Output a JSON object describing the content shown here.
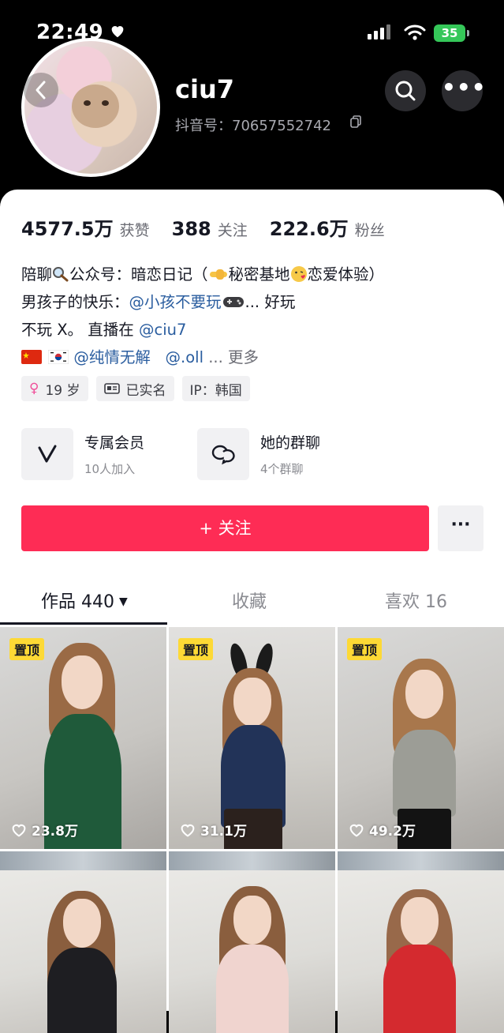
{
  "status_bar": {
    "time": "22:49",
    "battery": "35"
  },
  "profile": {
    "username": "ciu7",
    "douyin_id": "抖音号：70657552742"
  },
  "stats": [
    {
      "value": "4577.5万",
      "label": "获赞"
    },
    {
      "value": "388",
      "label": "关注"
    },
    {
      "value": "222.6万",
      "label": "粉丝"
    }
  ],
  "bio": {
    "line1_a": "陪聊",
    "line1_b": "公众号：暗恋日记（",
    "line1_c": "秘密基地",
    "line1_d": "恋爱体验）",
    "line2_a": "男孩子的快乐：",
    "line2_mention": "@小孩不要玩",
    "line2_b": "... 好玩",
    "line3_a": "不玩 X。 直播在 ",
    "line3_mention": "@ciu7",
    "line4_mention1": "@纯情无解",
    "line4_mention2": "@.oll",
    "line4_more": "... 更多"
  },
  "tags": [
    {
      "icon": "female-icon",
      "label": "19 岁"
    },
    {
      "icon": "id-card-icon",
      "label": "已实名"
    },
    {
      "icon": "",
      "label": "IP：韩国"
    }
  ],
  "features": [
    {
      "icon": "v-badge-icon",
      "title": "专属会员",
      "subtitle": "10人加入"
    },
    {
      "icon": "chat-bubbles-icon",
      "title": "她的群聊",
      "subtitle": "4个群聊"
    }
  ],
  "follow_label": "+ 关注",
  "follow_color": "#fe2c55",
  "tabs": [
    {
      "label": "作品 440"
    },
    {
      "label": "收藏"
    },
    {
      "label": "喜欢 16"
    }
  ],
  "videos": [
    {
      "pinned": "置顶",
      "likes": "23.8万"
    },
    {
      "pinned": "置顶",
      "likes": "31.1万"
    },
    {
      "pinned": "置顶",
      "likes": "49.2万"
    },
    {
      "pinned": "",
      "likes": ""
    },
    {
      "pinned": "",
      "likes": ""
    },
    {
      "pinned": "",
      "likes": ""
    }
  ]
}
